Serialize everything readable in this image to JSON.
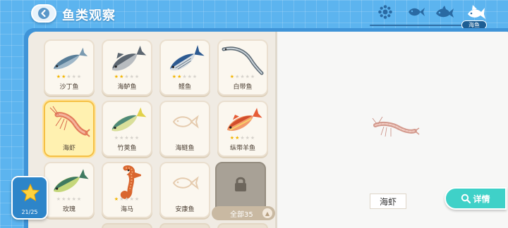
{
  "header": {
    "title": "鱼类观察",
    "active_tab_label": "海鱼",
    "tabs": [
      {
        "icon": "flower-filter-icon"
      },
      {
        "icon": "fish-filter-icon"
      },
      {
        "icon": "big-fish-filter-icon"
      },
      {
        "icon": "sea-fish-filter-icon"
      }
    ]
  },
  "grid": {
    "cards": [
      {
        "name": "沙丁鱼",
        "stars": 2,
        "icon": "sardine-icon"
      },
      {
        "name": "海鲈鱼",
        "stars": 2,
        "icon": "sea-bass-icon"
      },
      {
        "name": "鲣鱼",
        "stars": 2,
        "icon": "skipjack-tuna-icon"
      },
      {
        "name": "白带鱼",
        "stars": 1,
        "icon": "cutlassfish-icon"
      },
      {
        "name": "海虾",
        "stars": 0,
        "icon": "shrimp-icon",
        "selected": true
      },
      {
        "name": "竹荚鱼",
        "stars": 0,
        "icon": "horse-mackerel-icon"
      },
      {
        "name": "海鲢鱼",
        "stars": 0,
        "icon": "fish-silhouette-icon"
      },
      {
        "name": "纵带羊鱼",
        "stars": 2,
        "icon": "goatfish-icon"
      },
      {
        "name": "玫瑰",
        "stars": 0,
        "icon": "green-fish-icon"
      },
      {
        "name": "海马",
        "stars": 1,
        "icon": "seahorse-icon"
      },
      {
        "name": "安康鱼",
        "stars": 0,
        "icon": "fish-silhouette-icon"
      }
    ],
    "all_label": "全部35"
  },
  "detail": {
    "fish_name": "海虾",
    "detail_button_label": "详情"
  },
  "progress": {
    "label": "21/25"
  },
  "colors": {
    "background": "#5cb4ef",
    "accent_teal": "#3fd1c8",
    "selected_card": "#fff1b0",
    "star": "#f2b400"
  }
}
